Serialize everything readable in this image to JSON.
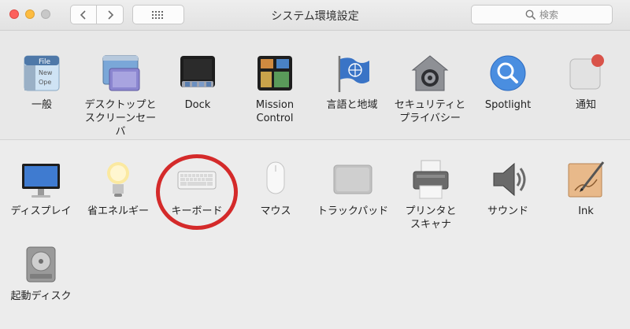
{
  "window": {
    "title": "システム環境設定",
    "search_placeholder": "検索"
  },
  "toolbar": {
    "back_icon": "chevron-left-icon",
    "forward_icon": "chevron-right-icon",
    "grid_icon": "grid-icon",
    "search_icon": "magnifier-icon"
  },
  "colors": {
    "close": "#fc605c",
    "minimize": "#fdbc40",
    "highlight_circle": "#d42a2a"
  },
  "personal_prefs": [
    {
      "label": "一般",
      "icon": "general-icon"
    },
    {
      "label": "デスクトップと\nスクリーンセーバ",
      "icon": "desktop-icon"
    },
    {
      "label": "Dock",
      "icon": "dock-icon"
    },
    {
      "label": "Mission\nControl",
      "icon": "mission-control-icon"
    },
    {
      "label": "言語と地域",
      "icon": "language-flag-icon"
    },
    {
      "label": "セキュリティと\nプライバシー",
      "icon": "security-house-icon"
    },
    {
      "label": "Spotlight",
      "icon": "spotlight-icon"
    },
    {
      "label": "通知",
      "icon": "notifications-icon"
    }
  ],
  "hardware_prefs": [
    {
      "label": "ディスプレイ",
      "icon": "display-icon"
    },
    {
      "label": "省エネルギー",
      "icon": "lightbulb-icon"
    },
    {
      "label": "キーボード",
      "icon": "keyboard-icon"
    },
    {
      "label": "マウス",
      "icon": "mouse-icon"
    },
    {
      "label": "トラックパッド",
      "icon": "trackpad-icon"
    },
    {
      "label": "プリンタと\nスキャナ",
      "icon": "printer-icon"
    },
    {
      "label": "サウンド",
      "icon": "speaker-icon"
    },
    {
      "label": "Ink",
      "icon": "ink-icon"
    }
  ],
  "system_prefs": [
    {
      "label": "起動ディスク",
      "icon": "hard-disk-icon"
    }
  ]
}
